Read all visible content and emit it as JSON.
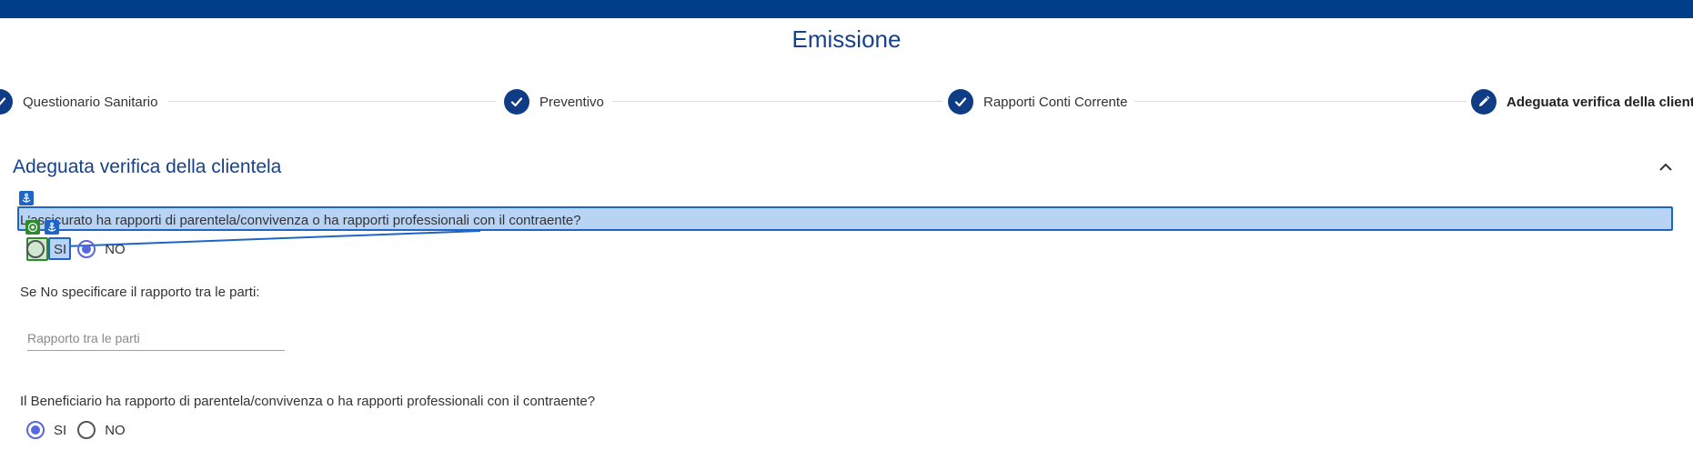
{
  "header": {
    "title": "Emissione"
  },
  "stepper": {
    "steps": [
      {
        "label": "Questionario Sanitario",
        "icon": "check-icon",
        "state": "completed"
      },
      {
        "label": "Preventivo",
        "icon": "check-icon",
        "state": "completed"
      },
      {
        "label": "Rapporti Conti Corrente",
        "icon": "check-icon",
        "state": "completed"
      },
      {
        "label": "Adeguata verifica della cliente",
        "icon": "edit-icon",
        "state": "active"
      }
    ]
  },
  "section": {
    "title": "Adeguata verifica della clientela",
    "collapse_icon": "chevron-up-icon"
  },
  "questions": [
    {
      "text": "L'assicurato ha rapporti di parentela/convivenza o ha rapporti professionali con il contraente?",
      "options": [
        {
          "label": "SI",
          "checked": false
        },
        {
          "label": "NO",
          "checked": true
        }
      ]
    },
    {
      "text": "Il Beneficiario ha rapporto di parentela/convivenza o ha rapporti professionali con il contraente?",
      "options": [
        {
          "label": "SI",
          "checked": true
        },
        {
          "label": "NO",
          "checked": false
        }
      ]
    }
  ],
  "relationship_field": {
    "label": "Se No specificare il rapporto tra le parti:",
    "placeholder": "Rapporto tra le parti",
    "value": ""
  },
  "colors": {
    "topbar": "#003e8a",
    "title": "#16418c",
    "step_circle": "#0f3d85",
    "radio_checked": "#5668e0",
    "annotation_blue": "#1f65c8",
    "annotation_green": "#2d8a2d"
  }
}
